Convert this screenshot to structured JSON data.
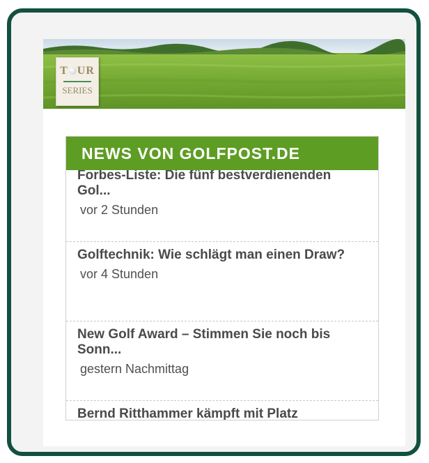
{
  "banner": {
    "logo_top_left": "T",
    "logo_top_right": "UR",
    "logo_bottom": "SERIES",
    "colors": {
      "frame": "#12503f",
      "grass": "#7fae3c",
      "header": "#5e9d24"
    }
  },
  "widget": {
    "title": "NEWS VON GOLFPOST.DE",
    "items": [
      {
        "title": "Forbes-Liste: Die fünf bestverdienenden Gol...",
        "time": "vor 2 Stunden"
      },
      {
        "title": "Golftechnik: Wie schlägt man einen Draw?",
        "time": "vor 4 Stunden"
      },
      {
        "title": "New Golf Award – Stimmen Sie noch bis Sonn...",
        "time": "gestern Nachmittag"
      },
      {
        "title": "Bernd Ritthammer kämpft mit Platz",
        "time": ""
      }
    ]
  }
}
